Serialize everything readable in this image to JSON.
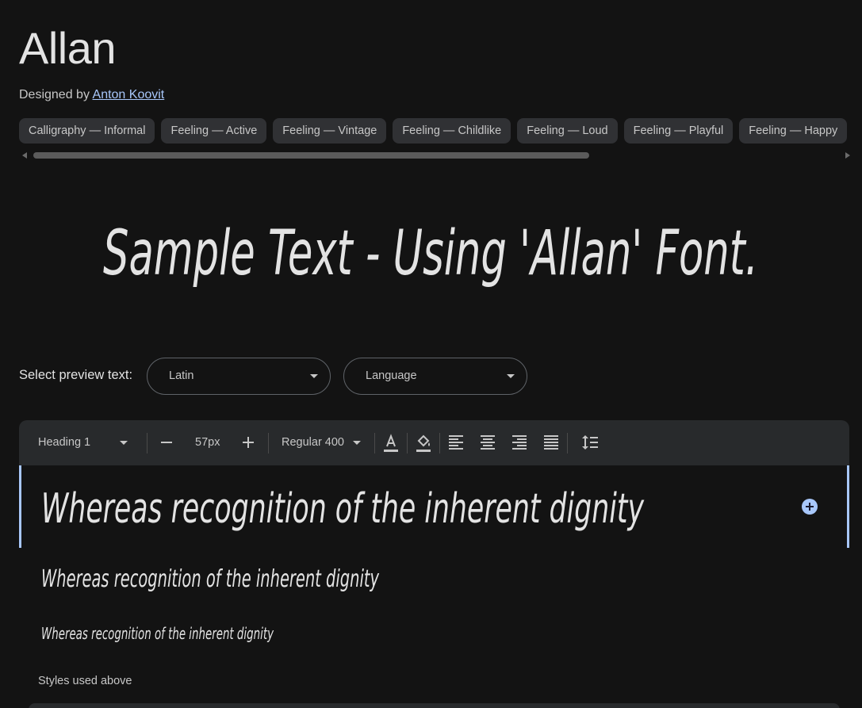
{
  "page": {
    "title": "Allan",
    "designed_by_prefix": "Designed by",
    "designer": "Anton Koovit"
  },
  "tags": [
    "Calligraphy — Informal",
    "Feeling — Active",
    "Feeling — Vintage",
    "Feeling — Childlike",
    "Feeling — Loud",
    "Feeling — Playful",
    "Feeling — Happy"
  ],
  "hero": {
    "text": "Sample Text - Using 'Allan' Font."
  },
  "preview": {
    "label": "Select preview text:",
    "script_select": "Latin",
    "language_select": "Language"
  },
  "toolbar": {
    "style_select": "Heading 1",
    "decrease_icon": "minus-icon",
    "size": "57px",
    "increase_icon": "plus-icon",
    "weight_select": "Regular 400",
    "icons": [
      "text-color-icon",
      "highlight-color-icon",
      "align-left-icon",
      "align-center-icon",
      "align-right-icon",
      "align-justify-icon",
      "line-height-icon"
    ]
  },
  "samples": [
    "Whereas recognition of the inherent dignity",
    "Whereas recognition of the inherent dignity",
    "Whereas recognition of the inherent dignity"
  ],
  "styles_used_label": "Styles used above",
  "colors": {
    "background": "#131313",
    "chip": "#303134",
    "accent": "#a8c7fa",
    "toolbar": "#282a2c"
  }
}
